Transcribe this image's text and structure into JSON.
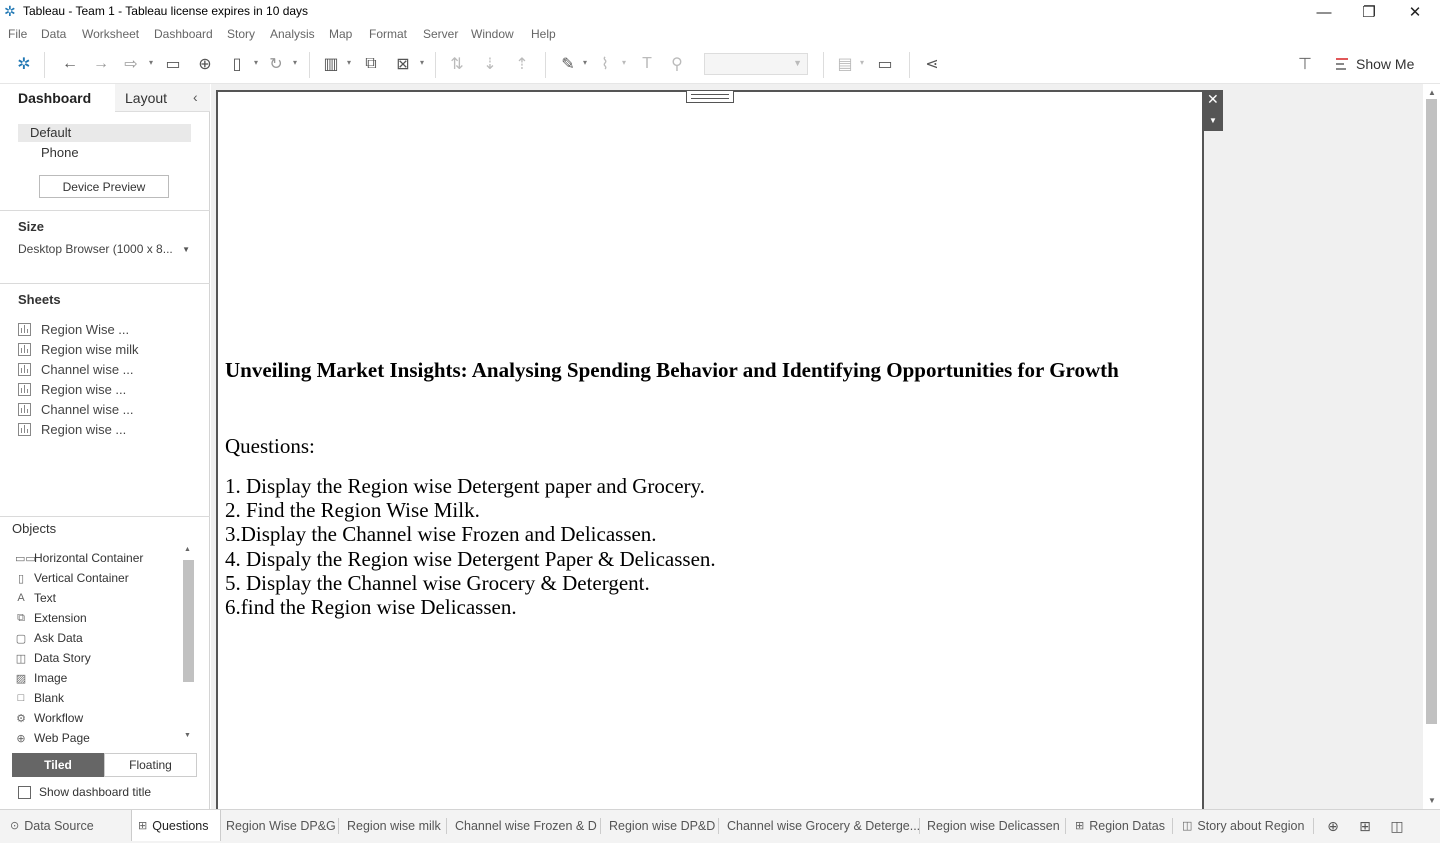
{
  "window": {
    "title": "Tableau - Team 1 - Tableau license expires in 10 days",
    "minimize": "—",
    "restore": "❐",
    "close": "✕"
  },
  "menu": [
    "File",
    "Data",
    "Worksheet",
    "Dashboard",
    "Story",
    "Analysis",
    "Map",
    "Format",
    "Server",
    "Window",
    "Help"
  ],
  "toolbar": {
    "show_me_label": "Show Me",
    "fit_select_value": ""
  },
  "left_panel": {
    "tabs": {
      "dashboard": "Dashboard",
      "layout": "Layout"
    },
    "devices": {
      "default": "Default",
      "phone": "Phone"
    },
    "device_preview": "Device Preview",
    "size_title": "Size",
    "size_value": "Desktop Browser (1000 x 8...",
    "sheets_title": "Sheets",
    "sheets": [
      "Region Wise ...",
      "Region wise milk",
      "Channel wise ...",
      "Region wise ...",
      "Channel wise ...",
      "Region wise ..."
    ],
    "objects_title": "Objects",
    "objects": [
      {
        "label": "Horizontal Container",
        "icon": "horizontal-container-icon"
      },
      {
        "label": "Vertical Container",
        "icon": "vertical-container-icon"
      },
      {
        "label": "Text",
        "icon": "text-icon"
      },
      {
        "label": "Extension",
        "icon": "extension-icon"
      },
      {
        "label": "Ask Data",
        "icon": "ask-data-icon"
      },
      {
        "label": "Data Story",
        "icon": "data-story-icon"
      },
      {
        "label": "Image",
        "icon": "image-icon"
      },
      {
        "label": "Blank",
        "icon": "blank-icon"
      },
      {
        "label": "Workflow",
        "icon": "workflow-icon"
      },
      {
        "label": "Web Page",
        "icon": "web-page-icon"
      }
    ],
    "tiled": "Tiled",
    "floating": "Floating",
    "show_dashboard_title": "Show dashboard title"
  },
  "dashboard": {
    "title": "Unveiling Market Insights: Analysing Spending Behavior and Identifying Opportunities for Growth",
    "questions_heading": "Questions:",
    "questions": [
      "1. Display the Region wise Detergent paper and Grocery.",
      "2. Find the Region Wise Milk.",
      "3.Display the Channel wise Frozen and Delicassen.",
      "4. Dispaly the Region wise Detergent Paper & Delicassen.",
      "5. Display the Channel wise Grocery & Detergent.",
      "6.find the Region wise Delicassen."
    ]
  },
  "bottom_tabs": {
    "data_source": "Data Source",
    "tabs": [
      "Questions",
      "Region Wise DP&G",
      "Region wise milk",
      "Channel wise Frozen & D",
      "Region wise DP&D",
      "Channel wise Grocery & Deterge...",
      "Region wise Delicassen",
      "Region Datas",
      "Story about Region"
    ]
  }
}
